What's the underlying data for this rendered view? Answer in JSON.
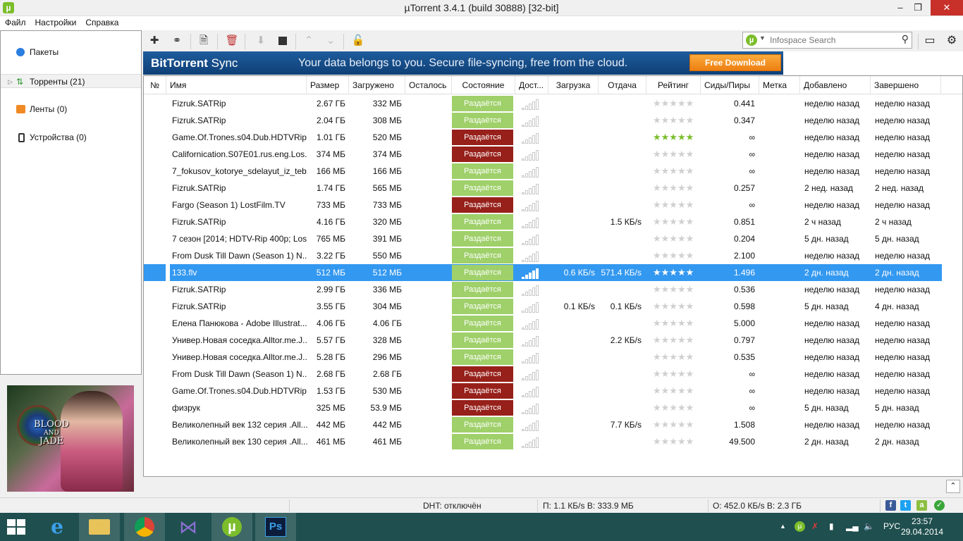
{
  "window": {
    "title": "µTorrent 3.4.1  (build 30888) [32-bit]"
  },
  "menu": [
    "Файл",
    "Настройки",
    "Справка"
  ],
  "sidebar": {
    "items": [
      {
        "label": "Пакеты"
      },
      {
        "label": "Торренты (21)"
      },
      {
        "label": "Ленты (0)"
      },
      {
        "label": "Устройства (0)"
      }
    ]
  },
  "ad": {
    "title_line1": "BLOOD",
    "title_line2": "AND",
    "title_line3": "JADE"
  },
  "search": {
    "placeholder": "Infospace Search"
  },
  "banner": {
    "brand_bold": "BitTorrent",
    "brand_light": " Sync",
    "tagline": "Your data belongs to you.  Secure file-syncing, free from the cloud.",
    "button": "Free Download"
  },
  "table": {
    "columns": [
      "№",
      "Имя",
      "Размер",
      "Загружено",
      "Осталось",
      "Состояние",
      "Дост...",
      "Загрузка",
      "Отдача",
      "Рейтинг",
      "Сиды/Пиры",
      "Метка",
      "Добавлено",
      "Завершено"
    ],
    "rows": [
      {
        "name": "Fizruk.SATRip",
        "size": "2.67 ГБ",
        "done": "332 МБ",
        "left": "",
        "status": "Раздаётся",
        "status_color": "green",
        "avail": 0,
        "down": "",
        "up": "",
        "rating": 0,
        "ratio": "0.441",
        "label": "",
        "added": "неделю назад",
        "completed": "неделю назад"
      },
      {
        "name": "Fizruk.SATRip",
        "size": "2.04 ГБ",
        "done": "308 МБ",
        "left": "",
        "status": "Раздаётся",
        "status_color": "green",
        "avail": 0,
        "down": "",
        "up": "",
        "rating": 0,
        "ratio": "0.347",
        "label": "",
        "added": "неделю назад",
        "completed": "неделю назад"
      },
      {
        "name": "Game.Of.Trones.s04.Dub.HDTVRip",
        "size": "1.01 ГБ",
        "done": "520 МБ",
        "left": "",
        "status": "Раздаётся",
        "status_color": "red",
        "avail": 0,
        "down": "",
        "up": "",
        "rating": 5,
        "ratio": "∞",
        "label": "",
        "added": "неделю назад",
        "completed": "неделю назад"
      },
      {
        "name": "Californication.S07E01.rus.eng.Los...",
        "size": "374 МБ",
        "done": "374 МБ",
        "left": "",
        "status": "Раздаётся",
        "status_color": "red",
        "avail": 0,
        "down": "",
        "up": "",
        "rating": 0,
        "ratio": "∞",
        "label": "",
        "added": "неделю назад",
        "completed": "неделю назад"
      },
      {
        "name": "7_fokusov_kotorye_sdelayut_iz_teb...",
        "size": "166 МБ",
        "done": "166 МБ",
        "left": "",
        "status": "Раздаётся",
        "status_color": "green",
        "avail": 0,
        "down": "",
        "up": "",
        "rating": 0,
        "ratio": "∞",
        "label": "",
        "added": "неделю назад",
        "completed": "неделю назад"
      },
      {
        "name": "Fizruk.SATRip",
        "size": "1.74 ГБ",
        "done": "565 МБ",
        "left": "",
        "status": "Раздаётся",
        "status_color": "green",
        "avail": 0,
        "down": "",
        "up": "",
        "rating": 0,
        "ratio": "0.257",
        "label": "",
        "added": "2 нед. назад",
        "completed": "2 нед. назад"
      },
      {
        "name": "Fargo (Season 1) LostFilm.TV",
        "size": "733 МБ",
        "done": "733 МБ",
        "left": "",
        "status": "Раздаётся",
        "status_color": "red",
        "avail": 0,
        "down": "",
        "up": "",
        "rating": 0,
        "ratio": "∞",
        "label": "",
        "added": "неделю назад",
        "completed": "неделю назад"
      },
      {
        "name": "Fizruk.SATRip",
        "size": "4.16 ГБ",
        "done": "320 МБ",
        "left": "",
        "status": "Раздаётся",
        "status_color": "green",
        "avail": 0,
        "down": "",
        "up": "1.5 КБ/s",
        "rating": 0,
        "ratio": "0.851",
        "label": "",
        "added": "2 ч назад",
        "completed": "2 ч назад"
      },
      {
        "name": "7 сезон [2014; HDTV-Rip 400p; Los...",
        "size": "765 МБ",
        "done": "391 МБ",
        "left": "",
        "status": "Раздаётся",
        "status_color": "green",
        "avail": 0,
        "down": "",
        "up": "",
        "rating": 0,
        "ratio": "0.204",
        "label": "",
        "added": "5 дн. назад",
        "completed": "5 дн. назад"
      },
      {
        "name": "From Dusk Till Dawn (Season 1) N...",
        "size": "3.22 ГБ",
        "done": "550 МБ",
        "left": "",
        "status": "Раздаётся",
        "status_color": "green",
        "avail": 0,
        "down": "",
        "up": "",
        "rating": 0,
        "ratio": "2.100",
        "label": "",
        "added": "неделю назад",
        "completed": "неделю назад"
      },
      {
        "name": "133.flv",
        "size": "512 МБ",
        "done": "512 МБ",
        "left": "",
        "status": "Раздаётся",
        "status_color": "green",
        "avail": 3,
        "down": "0.6 КБ/s",
        "up": "571.4 КБ/s",
        "rating": 5,
        "ratio": "1.496",
        "label": "",
        "added": "2 дн. назад",
        "completed": "2 дн. назад",
        "selected": true
      },
      {
        "name": "Fizruk.SATRip",
        "size": "2.99 ГБ",
        "done": "336 МБ",
        "left": "",
        "status": "Раздаётся",
        "status_color": "green",
        "avail": 0,
        "down": "",
        "up": "",
        "rating": 0,
        "ratio": "0.536",
        "label": "",
        "added": "неделю назад",
        "completed": "неделю назад"
      },
      {
        "name": "Fizruk.SATRip",
        "size": "3.55 ГБ",
        "done": "304 МБ",
        "left": "",
        "status": "Раздаётся",
        "status_color": "green",
        "avail": 0,
        "down": "0.1 КБ/s",
        "up": "0.1 КБ/s",
        "rating": 0,
        "ratio": "0.598",
        "label": "",
        "added": "5 дн. назад",
        "completed": "4 дн. назад"
      },
      {
        "name": "Елена Панюкова - Adobe Illustrat...",
        "size": "4.06 ГБ",
        "done": "4.06 ГБ",
        "left": "",
        "status": "Раздаётся",
        "status_color": "green",
        "avail": 0,
        "down": "",
        "up": "",
        "rating": 0,
        "ratio": "5.000",
        "label": "",
        "added": "неделю назад",
        "completed": "неделю назад"
      },
      {
        "name": "Универ.Новая соседка.Alltor.me.J...",
        "size": "5.57 ГБ",
        "done": "328 МБ",
        "left": "",
        "status": "Раздаётся",
        "status_color": "green",
        "avail": 0,
        "down": "",
        "up": "2.2 КБ/s",
        "rating": 0,
        "ratio": "0.797",
        "label": "",
        "added": "неделю назад",
        "completed": "неделю назад"
      },
      {
        "name": "Универ.Новая соседка.Alltor.me.J...",
        "size": "5.28 ГБ",
        "done": "296 МБ",
        "left": "",
        "status": "Раздаётся",
        "status_color": "green",
        "avail": 0,
        "down": "",
        "up": "",
        "rating": 0,
        "ratio": "0.535",
        "label": "",
        "added": "неделю назад",
        "completed": "неделю назад"
      },
      {
        "name": "From Dusk Till Dawn (Season 1) N...",
        "size": "2.68 ГБ",
        "done": "2.68 ГБ",
        "left": "",
        "status": "Раздаётся",
        "status_color": "red",
        "avail": 0,
        "down": "",
        "up": "",
        "rating": 0,
        "ratio": "∞",
        "label": "",
        "added": "неделю назад",
        "completed": "неделю назад"
      },
      {
        "name": "Game.Of.Trones.s04.Dub.HDTVRip",
        "size": "1.53 ГБ",
        "done": "530 МБ",
        "left": "",
        "status": "Раздаётся",
        "status_color": "red",
        "avail": 0,
        "down": "",
        "up": "",
        "rating": 0,
        "ratio": "∞",
        "label": "",
        "added": "неделю назад",
        "completed": "неделю назад"
      },
      {
        "name": "физрук",
        "size": "325 МБ",
        "done": "53.9 МБ",
        "left": "",
        "status": "Раздаётся",
        "status_color": "red",
        "avail": 0,
        "down": "",
        "up": "",
        "rating": 0,
        "ratio": "∞",
        "label": "",
        "added": "5 дн. назад",
        "completed": "5 дн. назад"
      },
      {
        "name": "Великолепный век 132 серия .All...",
        "size": "442 МБ",
        "done": "442 МБ",
        "left": "",
        "status": "Раздаётся",
        "status_color": "green",
        "avail": 0,
        "down": "",
        "up": "7.7 КБ/s",
        "rating": 0,
        "ratio": "1.508",
        "label": "",
        "added": "неделю назад",
        "completed": "неделю назад"
      },
      {
        "name": "Великолепный век 130 серия .All...",
        "size": "461 МБ",
        "done": "461 МБ",
        "left": "",
        "status": "Раздаётся",
        "status_color": "green",
        "avail": 0,
        "down": "",
        "up": "",
        "rating": 0,
        "ratio": "49.500",
        "label": "",
        "added": "2 дн. назад",
        "completed": "2 дн. назад"
      }
    ]
  },
  "statusbar": {
    "dht": "DHT: отключён",
    "download": "П: 1.1 КБ/s В: 333.9 МБ",
    "upload": "О: 452.0 КБ/s В: 2.3 ГБ"
  },
  "taskbar": {
    "apps": [
      "internet-explorer",
      "file-explorer",
      "chrome",
      "visual-studio",
      "utorrent",
      "photoshop"
    ],
    "photoshop_label": "Ps",
    "language": "РУС",
    "time": "23:57",
    "date": "29.04.2014"
  },
  "colors": {
    "status_green": "#9fd06a",
    "status_red": "#97201a",
    "selection": "#3398f0",
    "taskbar": "#1f4f4e",
    "utorrent_green": "#7bbd2b"
  }
}
